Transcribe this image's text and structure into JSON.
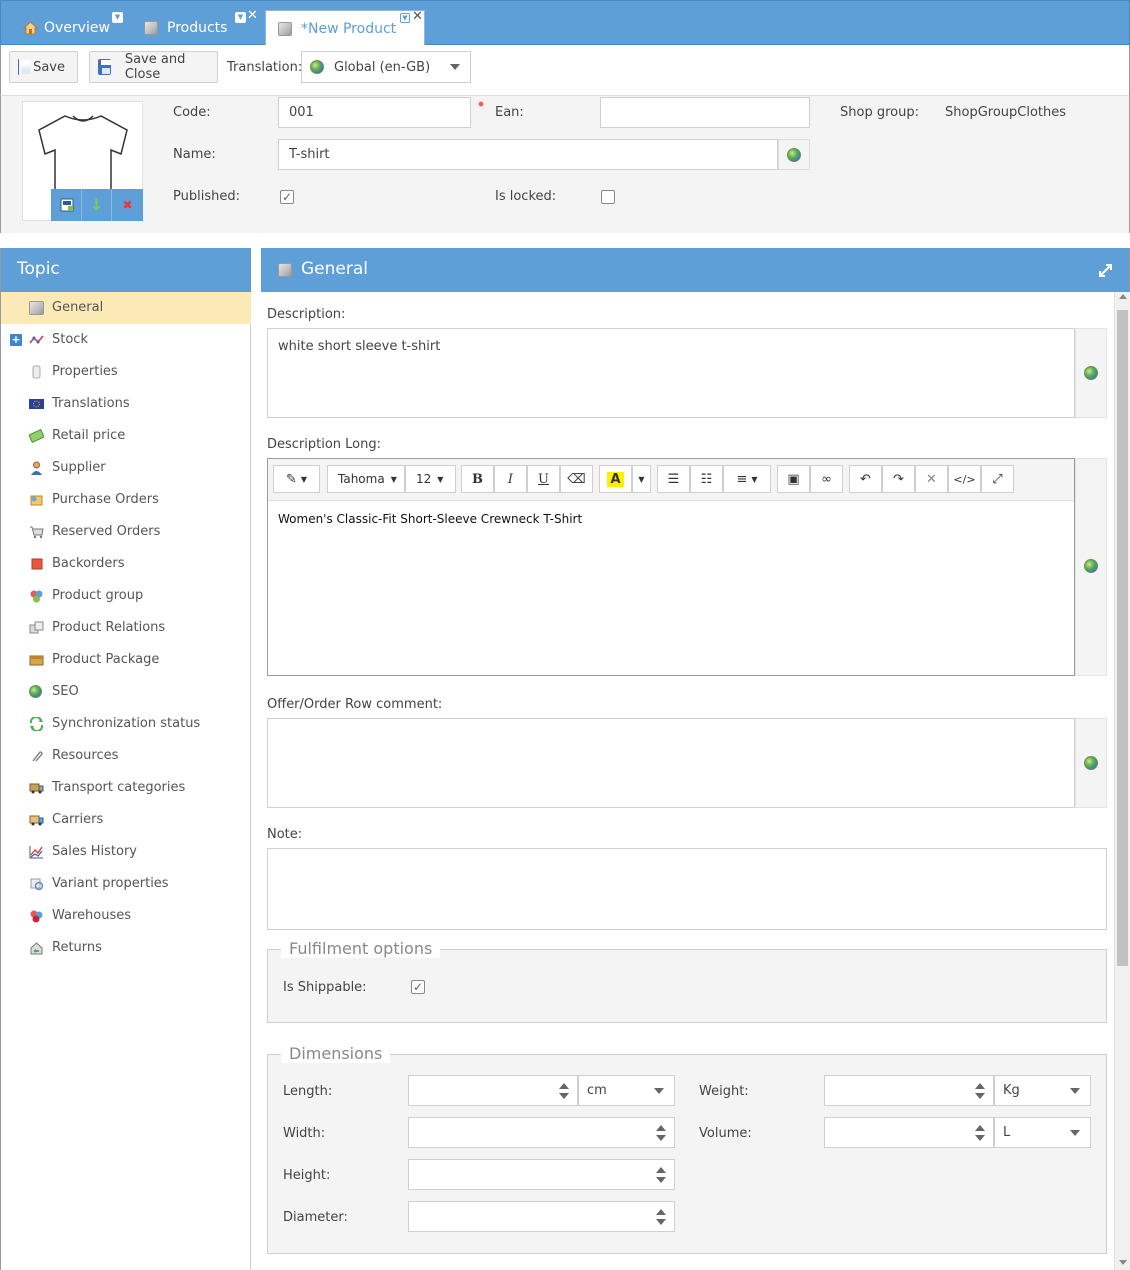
{
  "tabs": [
    {
      "label": "Overview"
    },
    {
      "label": "Products"
    },
    {
      "label": "*New Product"
    }
  ],
  "toolbar": {
    "save_label": "Save",
    "save_close_label": "Save and Close",
    "translation_label": "Translation:",
    "translation_value": "Global (en-GB)"
  },
  "header": {
    "code_label": "Code:",
    "code_value": "001",
    "ean_label": "Ean:",
    "ean_value": "",
    "shop_group_label": "Shop group:",
    "shop_group_value": "ShopGroupClothes",
    "name_label": "Name:",
    "name_value": "T-shirt",
    "published_label": "Published:",
    "published_checked": true,
    "is_locked_label": "Is locked:",
    "is_locked_checked": false
  },
  "sidebar": {
    "title": "Topic",
    "items": [
      {
        "label": "General",
        "icon": "cube-icon"
      },
      {
        "label": "Stock",
        "icon": "stock-chart-icon"
      },
      {
        "label": "Properties",
        "icon": "properties-icon"
      },
      {
        "label": "Translations",
        "icon": "eu-flag-icon"
      },
      {
        "label": "Retail price",
        "icon": "money-icon"
      },
      {
        "label": "Supplier",
        "icon": "person-icon"
      },
      {
        "label": "Purchase Orders",
        "icon": "purchase-orders-icon"
      },
      {
        "label": "Reserved Orders",
        "icon": "cart-icon"
      },
      {
        "label": "Backorders",
        "icon": "backorders-icon"
      },
      {
        "label": "Product group",
        "icon": "product-group-icon"
      },
      {
        "label": "Product Relations",
        "icon": "relations-icon"
      },
      {
        "label": "Product Package",
        "icon": "package-icon"
      },
      {
        "label": "SEO",
        "icon": "globe-icon"
      },
      {
        "label": "Synchronization status",
        "icon": "sync-icon"
      },
      {
        "label": "Resources",
        "icon": "paperclip-icon"
      },
      {
        "label": "Transport categories",
        "icon": "truck-icon"
      },
      {
        "label": "Carriers",
        "icon": "carrier-truck-icon"
      },
      {
        "label": "Sales History",
        "icon": "sales-chart-icon"
      },
      {
        "label": "Variant properties",
        "icon": "variant-icon"
      },
      {
        "label": "Warehouses",
        "icon": "warehouse-icon"
      },
      {
        "label": "Returns",
        "icon": "returns-icon"
      }
    ]
  },
  "main": {
    "title": "General",
    "description_label": "Description:",
    "description_value": "white short sleeve t-shirt",
    "description_long_label": "Description Long:",
    "rte_font": "Tahoma",
    "rte_size": "12",
    "description_long_value": "Women's Classic-Fit Short-Sleeve Crewneck T-Shirt",
    "offer_comment_label": "Offer/Order Row comment:",
    "offer_comment_value": "",
    "note_label": "Note:",
    "note_value": "",
    "fulfilment_title": "Fulfilment options",
    "is_shippable_label": "Is Shippable:",
    "is_shippable_checked": true,
    "dimensions_title": "Dimensions",
    "length_label": "Length:",
    "length_unit": "cm",
    "width_label": "Width:",
    "height_label": "Height:",
    "diameter_label": "Diameter:",
    "weight_label": "Weight:",
    "weight_unit": "Kg",
    "volume_label": "Volume:",
    "volume_unit": "L"
  },
  "colors": {
    "accent": "#5f9fd8",
    "selected_row": "#fbe9b6",
    "panel_bg": "#f4f4f4"
  }
}
